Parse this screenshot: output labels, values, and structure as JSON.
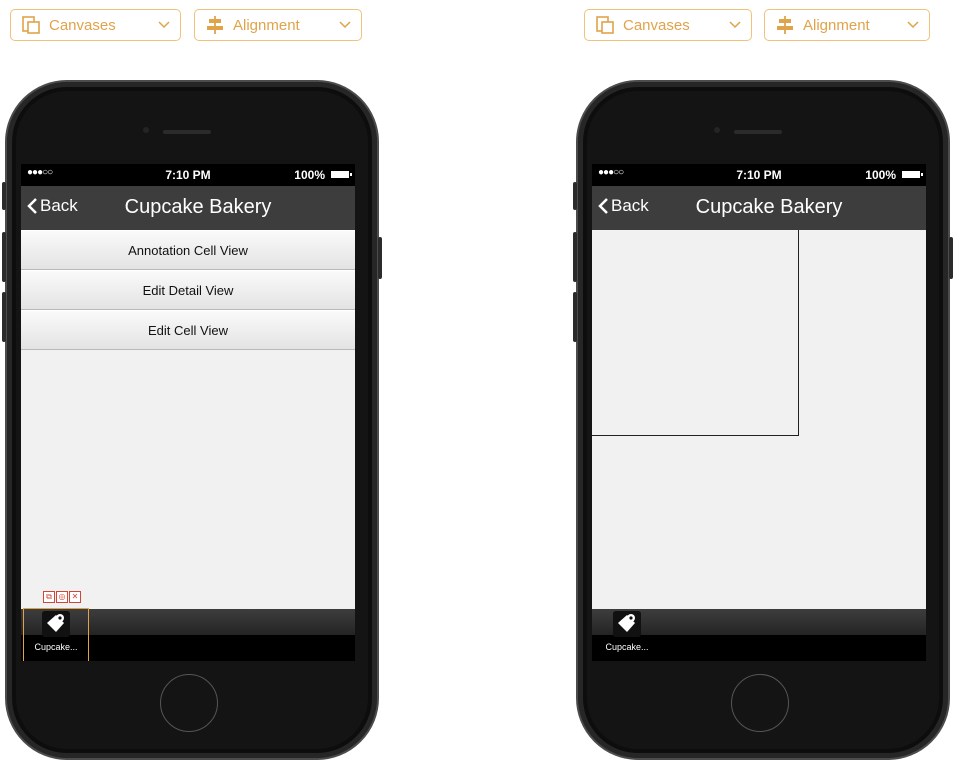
{
  "toolbar": {
    "canvases_label": "Canvases",
    "alignment_label": "Alignment"
  },
  "accent_color": "#e0a34a",
  "left_phone": {
    "status": {
      "signal": "●●●○○",
      "time": "7:10 PM",
      "battery": "100%"
    },
    "nav": {
      "back_label": "Back",
      "title": "Cupcake Bakery"
    },
    "cells": [
      "Annotation Cell View",
      "Edit Detail View",
      "Edit Cell View"
    ],
    "tab": {
      "label": "Cupcake...",
      "icon": "map-pin-icon"
    },
    "widget_actions": [
      "copy-icon",
      "settings-icon",
      "close-icon"
    ]
  },
  "right_phone": {
    "status": {
      "signal": "●●●○○",
      "time": "7:10 PM",
      "battery": "100%"
    },
    "nav": {
      "back_label": "Back",
      "title": "Cupcake Bakery"
    },
    "tab": {
      "label": "Cupcake...",
      "icon": "map-pin-icon"
    }
  }
}
